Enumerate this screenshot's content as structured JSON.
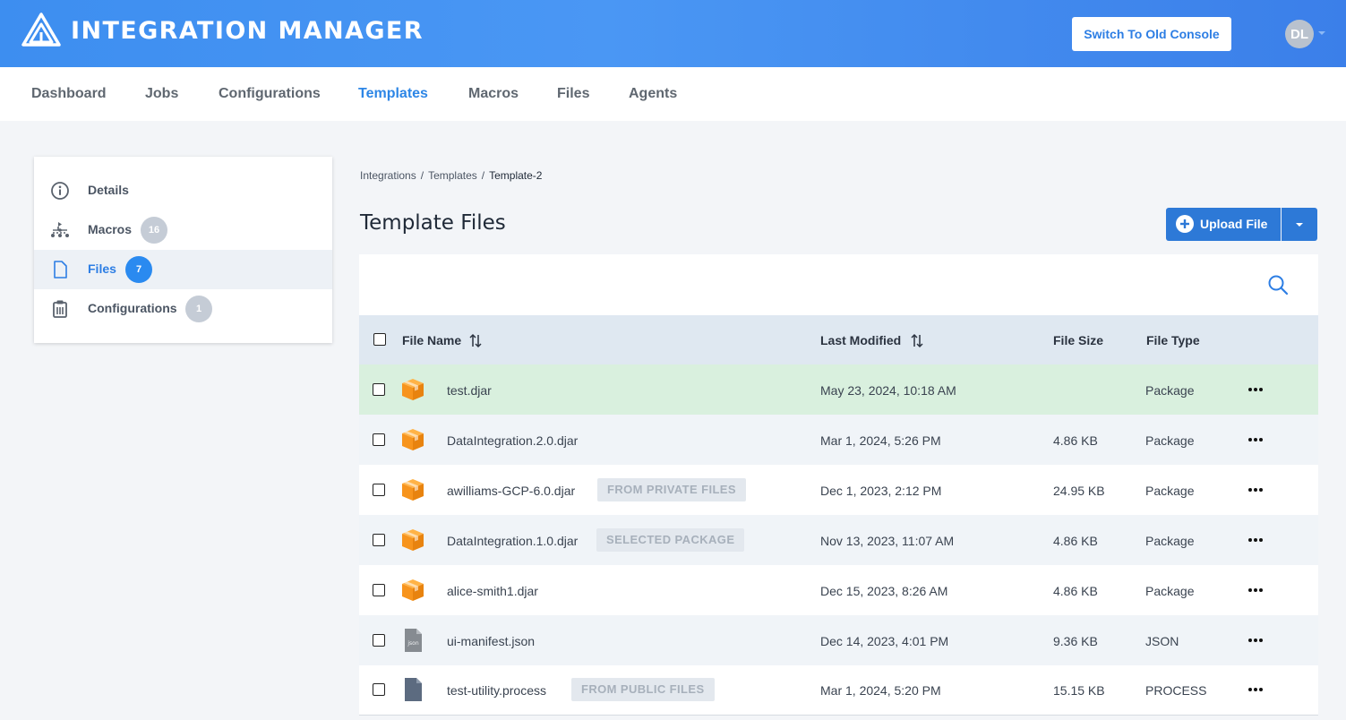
{
  "header": {
    "app_title": "INTEGRATION MANAGER",
    "switch_button": "Switch To Old Console",
    "avatar_initials": "DL",
    "logo_icon": "triangle-logo-icon"
  },
  "nav": {
    "items": [
      {
        "label": "Dashboard",
        "active": false
      },
      {
        "label": "Jobs",
        "active": false
      },
      {
        "label": "Configurations",
        "active": false
      },
      {
        "label": "Templates",
        "active": true
      },
      {
        "label": "Macros",
        "active": false
      },
      {
        "label": "Files",
        "active": false
      },
      {
        "label": "Agents",
        "active": false
      }
    ]
  },
  "sidebar": {
    "items": [
      {
        "label": "Details",
        "icon": "info-circle-icon",
        "badge": null,
        "active": false
      },
      {
        "label": "Macros",
        "icon": "macro-tree-icon",
        "badge": "16",
        "active": false
      },
      {
        "label": "Files",
        "icon": "file-icon",
        "badge": "7",
        "active": true
      },
      {
        "label": "Configurations",
        "icon": "clipboard-icon",
        "badge": "1",
        "active": false
      }
    ]
  },
  "breadcrumb": {
    "items": [
      "Integrations",
      "Templates"
    ],
    "separator": "/",
    "current": "Template-2"
  },
  "main": {
    "title": "Template Files",
    "upload_button": "Upload File"
  },
  "table": {
    "columns": {
      "name": "File Name",
      "modified": "Last Modified",
      "size": "File Size",
      "type": "File Type"
    },
    "rows": [
      {
        "name": "test.djar",
        "tag": "",
        "modified": "May 23, 2024, 10:18 AM",
        "size": "",
        "type": "Package",
        "icon": "package-box-icon",
        "highlight": true
      },
      {
        "name": "DataIntegration.2.0.djar",
        "tag": "",
        "modified": "Mar 1, 2024, 5:26 PM",
        "size": "4.86 KB",
        "type": "Package",
        "icon": "package-box-icon",
        "highlight": false
      },
      {
        "name": "awilliams-GCP-6.0.djar",
        "tag": "FROM PRIVATE FILES",
        "modified": "Dec 1, 2023, 2:12 PM",
        "size": "24.95 KB",
        "type": "Package",
        "icon": "package-box-icon",
        "highlight": false
      },
      {
        "name": "DataIntegration.1.0.djar",
        "tag": "SELECTED PACKAGE",
        "modified": "Nov 13, 2023, 11:07 AM",
        "size": "4.86 KB",
        "type": "Package",
        "icon": "package-box-icon",
        "highlight": false
      },
      {
        "name": "alice-smith1.djar",
        "tag": "",
        "modified": "Dec 15, 2023, 8:26 AM",
        "size": "4.86 KB",
        "type": "Package",
        "icon": "package-box-icon",
        "highlight": false
      },
      {
        "name": "ui-manifest.json",
        "tag": "",
        "modified": "Dec 14, 2023, 4:01 PM",
        "size": "9.36 KB",
        "type": "JSON",
        "icon": "json-file-icon",
        "icon_text": "json",
        "highlight": false
      },
      {
        "name": "test-utility.process",
        "tag": "FROM PUBLIC FILES",
        "modified": "Mar 1, 2024, 5:20 PM",
        "size": "15.15 KB",
        "type": "PROCESS",
        "icon": "process-file-icon",
        "highlight": false
      }
    ]
  },
  "colors": {
    "accent": "#2d86e6",
    "highlight_row": "#d9f0de",
    "striped_row": "#f0f4f8",
    "package_orange": "#f7941d"
  }
}
